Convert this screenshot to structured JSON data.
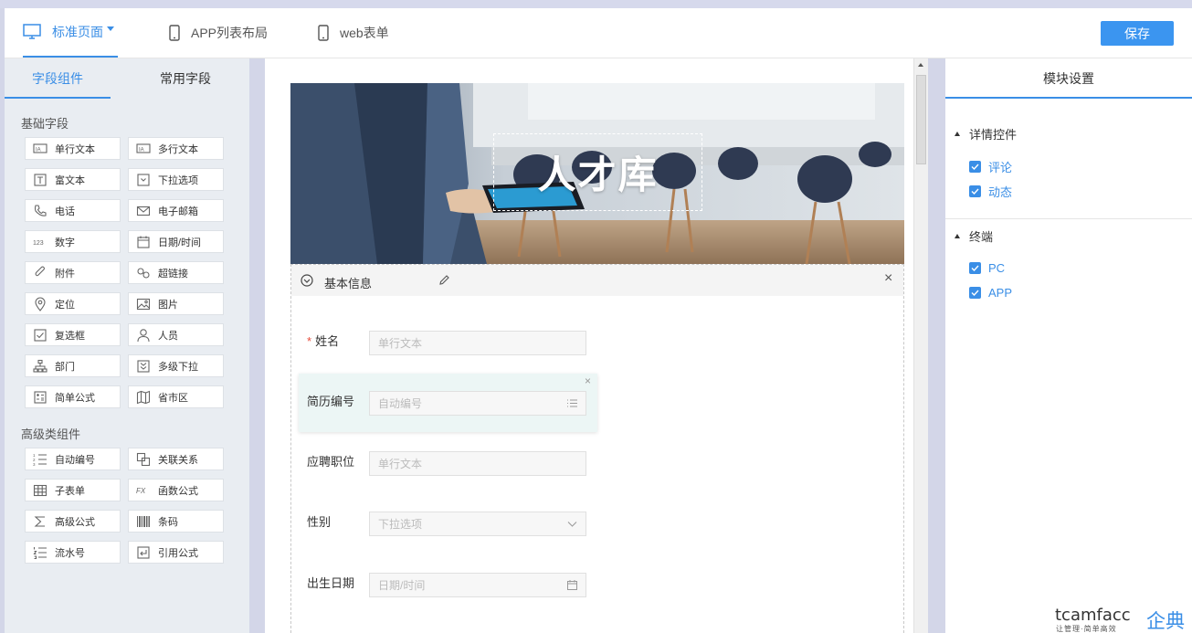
{
  "top_tabs": [
    {
      "label": "标准页面"
    },
    {
      "label": "APP列表布局"
    },
    {
      "label": "web表单"
    }
  ],
  "save_label": "保存",
  "left_tabs": [
    "字段组件",
    "常用字段"
  ],
  "basic_section": "基础字段",
  "basic_components": [
    {
      "label": "单行文本",
      "icon": "text-line-icon"
    },
    {
      "label": "多行文本",
      "icon": "text-multi-icon"
    },
    {
      "label": "富文本",
      "icon": "rich-text-icon"
    },
    {
      "label": "下拉选项",
      "icon": "dropdown-icon"
    },
    {
      "label": "电话",
      "icon": "phone-icon"
    },
    {
      "label": "电子邮箱",
      "icon": "mail-icon"
    },
    {
      "label": "数字",
      "icon": "number-icon"
    },
    {
      "label": "日期/时间",
      "icon": "calendar-icon"
    },
    {
      "label": "附件",
      "icon": "attachment-icon"
    },
    {
      "label": "超链接",
      "icon": "link-icon"
    },
    {
      "label": "定位",
      "icon": "location-icon"
    },
    {
      "label": "图片",
      "icon": "image-icon"
    },
    {
      "label": "复选框",
      "icon": "checkbox-icon"
    },
    {
      "label": "人员",
      "icon": "person-icon"
    },
    {
      "label": "部门",
      "icon": "org-icon"
    },
    {
      "label": "多级下拉",
      "icon": "multi-dropdown-icon"
    },
    {
      "label": "简单公式",
      "icon": "formula-icon"
    },
    {
      "label": "省市区",
      "icon": "map-icon"
    }
  ],
  "advanced_section": "高级类组件",
  "advanced_components": [
    {
      "label": "自动编号",
      "icon": "auto-number-icon"
    },
    {
      "label": "关联关系",
      "icon": "relation-icon"
    },
    {
      "label": "子表单",
      "icon": "subform-icon"
    },
    {
      "label": "函数公式",
      "icon": "function-icon"
    },
    {
      "label": "高级公式",
      "icon": "sigma-icon"
    },
    {
      "label": "条码",
      "icon": "barcode-icon"
    },
    {
      "label": "流水号",
      "icon": "serial-icon"
    },
    {
      "label": "引用公式",
      "icon": "reference-icon"
    }
  ],
  "banner_title": "人才库",
  "section_title": "基本信息",
  "form_fields": [
    {
      "label": "姓名",
      "placeholder": "单行文本",
      "required": "*"
    },
    {
      "label": "简历编号",
      "placeholder": "自动编号"
    },
    {
      "label": "应聘职位",
      "placeholder": "单行文本"
    },
    {
      "label": "性别",
      "placeholder": "下拉选项"
    },
    {
      "label": "出生日期",
      "placeholder": "日期/时间"
    }
  ],
  "right_panel": {
    "title": "模块设置",
    "groups": [
      {
        "title": "详情控件",
        "items": [
          "评论",
          "动态"
        ]
      },
      {
        "title": "终端",
        "items": [
          "PC",
          "APP"
        ]
      }
    ]
  },
  "logo": {
    "name": "tcamfacc",
    "cn": "企典",
    "slogan": "让管理·简单高效"
  },
  "colors": {
    "accent": "#3a8ee6",
    "save": "#3b95f0"
  }
}
